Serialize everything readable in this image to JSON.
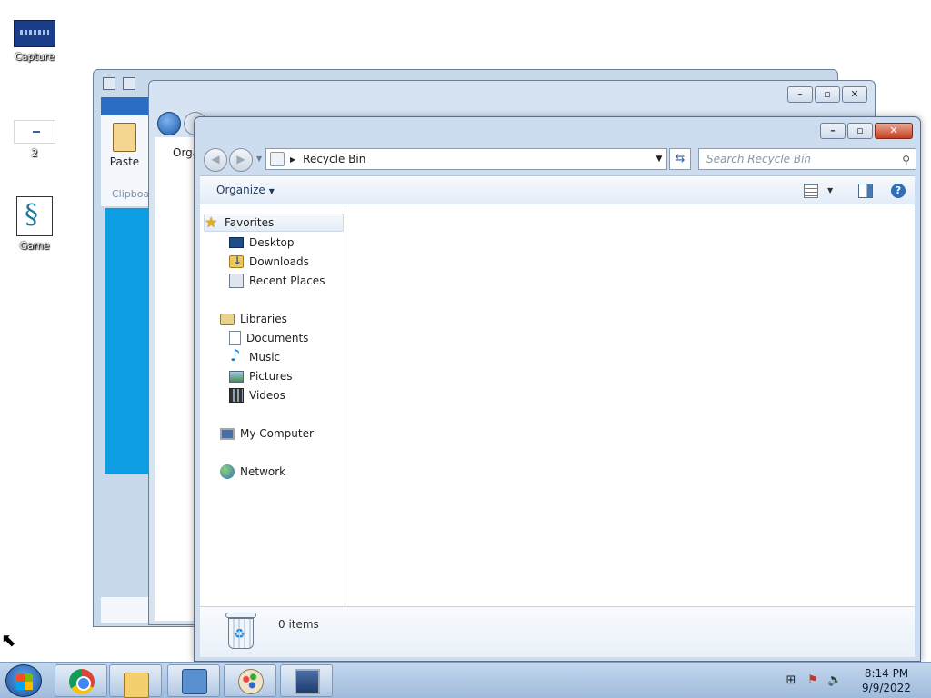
{
  "desktop": {
    "icons": [
      {
        "label": "Capture"
      },
      {
        "label": "2"
      },
      {
        "label": "Game"
      }
    ]
  },
  "back_window": {
    "paste_label": "Paste",
    "clipboard_label": "Clipboa"
  },
  "middle_window": {
    "organize_label": "Orga"
  },
  "main_window": {
    "address_path": "Recycle Bin",
    "search_placeholder": "Search Recycle Bin",
    "toolbar": {
      "organize_label": "Organize"
    },
    "nav": {
      "favorites": "Favorites",
      "desktop": "Desktop",
      "downloads": "Downloads",
      "recent_places": "Recent Places",
      "libraries": "Libraries",
      "documents": "Documents",
      "music": "Music",
      "pictures": "Pictures",
      "videos": "Videos",
      "my_computer": "My Computer",
      "network": "Network"
    },
    "details": {
      "item_count": "0 items"
    }
  },
  "taskbar": {
    "clock_time": "8:14 PM",
    "clock_date": "9/9/2022",
    "pinned": [
      "chrome-icon",
      "explorer-icon",
      "control-panel-icon",
      "paint-icon",
      "network-app-icon"
    ]
  },
  "colors": {
    "accent_blue": "#0c9de2",
    "close_button": "#c4401f",
    "taskbar": "#9fbbdc"
  }
}
